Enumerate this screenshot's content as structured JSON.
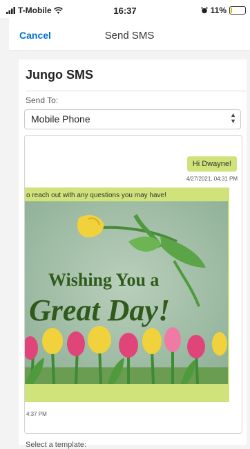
{
  "status_bar": {
    "carrier": "T-Mobile",
    "time": "16:37",
    "battery": "11%",
    "battery_level": 0.11
  },
  "nav": {
    "cancel_label": "Cancel",
    "title": "Send SMS"
  },
  "card": {
    "title": "Jungo SMS",
    "send_to_label": "Send To:",
    "send_to_value": "Mobile Phone",
    "template_label": "Select a template:"
  },
  "messages": {
    "outgoing": {
      "text": "Hi Dwayne!",
      "timestamp": "4/27/2021, 04:31 PM"
    },
    "incoming": {
      "text": "o reach out with any questions you may have!",
      "image_line1": "Wishing You a",
      "image_line2": "Great Day!",
      "timestamp": "4:37 PM"
    }
  },
  "colors": {
    "accent": "#0070d2",
    "bubble": "#cfe37a",
    "card_text_green": "#2f5a1c",
    "image_bg": "#9ebba4"
  },
  "icons": [
    "signal-bars-icon",
    "wifi-icon",
    "alarm-icon",
    "battery-icon",
    "select-arrows-icon"
  ]
}
